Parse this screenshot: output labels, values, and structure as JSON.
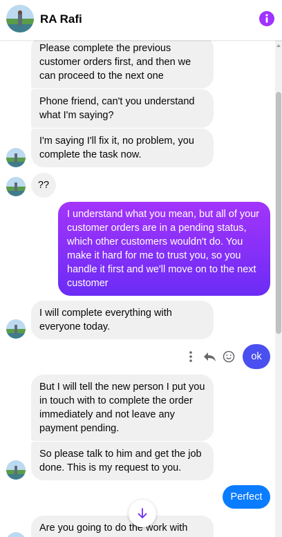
{
  "header": {
    "contact_name": "RA Rafi",
    "info_icon": "info-icon",
    "accent": "#a033ff"
  },
  "messages": [
    {
      "dir": "in",
      "text": "Please complete the previous customer orders first, and then we can proceed to the next one"
    },
    {
      "dir": "in",
      "text": "Phone friend, can't you understand what I'm saying?"
    },
    {
      "dir": "in",
      "text": "I'm saying I'll fix it, no problem, you complete the task now."
    },
    {
      "dir": "in",
      "text": "??"
    },
    {
      "dir": "out",
      "text": "I understand what you mean, but all of your customer orders are in a pending status, which other customers wouldn't do. You make it hard for me to trust you, so you handle it first and we'll move on to the next customer"
    },
    {
      "dir": "in",
      "text": "I will complete everything with everyone today."
    },
    {
      "dir": "out",
      "text": "ok"
    },
    {
      "dir": "in",
      "text": "But I will tell the new person I put you in touch with to complete the order immediately and not leave any payment pending."
    },
    {
      "dir": "in",
      "text": "So please talk to him and get the job done. This is my request to you."
    },
    {
      "dir": "out",
      "text": "Perfect"
    },
    {
      "dir": "in",
      "text": "Are you going to do the work with him?"
    }
  ],
  "message_actions": [
    "more-options-icon",
    "reply-icon",
    "react-emoji-icon"
  ],
  "colors": {
    "incoming_bubble": "#f0f0f0",
    "outgoing_gradient_start": "#a334fa",
    "outgoing_gradient_end": "#6b2cf5",
    "outgoing_blue": "#0a7cff",
    "outgoing_indigo": "#4a4ff0"
  }
}
